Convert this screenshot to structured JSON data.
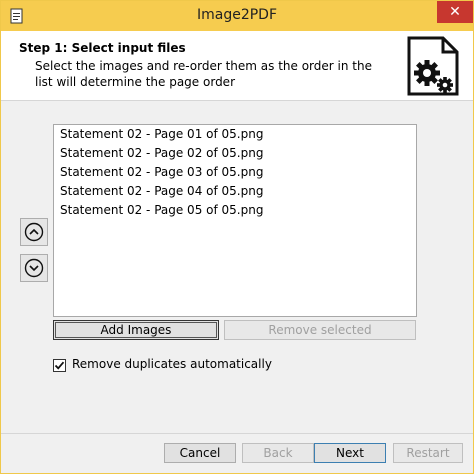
{
  "window": {
    "title": "Image2PDF",
    "close_glyph": "✕",
    "titlebar_color": "#f6cc4f",
    "close_color": "#c7372f"
  },
  "header": {
    "step_title": "Step 1: Select input files",
    "description": "Select the images and re-order them as the order in the list will determine the page order",
    "icon": "document-gears-icon"
  },
  "file_list": {
    "items": [
      "Statement 02 - Page 01 of 05.png",
      "Statement 02 - Page 02 of 05.png",
      "Statement 02 - Page 03 of 05.png",
      "Statement 02 - Page 04 of 05.png",
      "Statement 02 - Page 05 of 05.png"
    ]
  },
  "list_actions": {
    "add_images": "Add Images",
    "remove_selected": "Remove selected"
  },
  "options": {
    "remove_duplicates_label": "Remove duplicates automatically",
    "remove_duplicates_checked": true
  },
  "footer": {
    "cancel": "Cancel",
    "back": "Back",
    "next": "Next",
    "restart": "Restart"
  }
}
